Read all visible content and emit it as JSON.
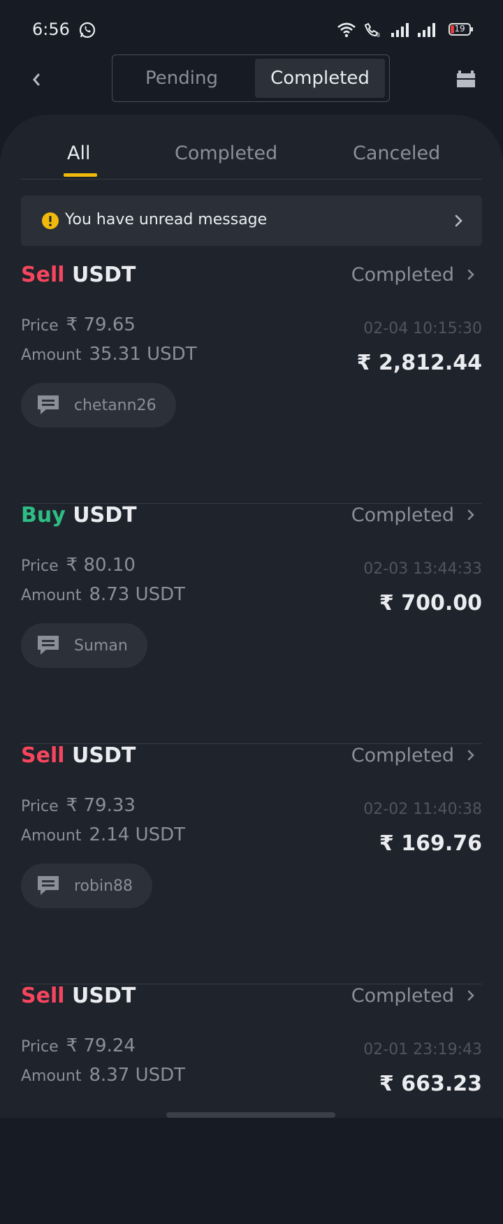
{
  "status_bar": {
    "time": "6:56",
    "battery": "19"
  },
  "header": {
    "segments": {
      "pending": "Pending",
      "completed": "Completed"
    },
    "selected_segment": "Completed"
  },
  "tabs": {
    "all": "All",
    "completed": "Completed",
    "canceled": "Canceled",
    "active": "All"
  },
  "notice": {
    "message": "You have unread message"
  },
  "orders": [
    {
      "side": "Sell",
      "asset": "USDT",
      "status": "Completed",
      "price_label": "Price",
      "price": "₹ 79.65",
      "amount_label": "Amount",
      "amount": "35.31 USDT",
      "timestamp": "02-04 10:15:30",
      "fiat_total": "₹ 2,812.44",
      "counterparty": "chetann26"
    },
    {
      "side": "Buy",
      "asset": "USDT",
      "status": "Completed",
      "price_label": "Price",
      "price": "₹ 80.10",
      "amount_label": "Amount",
      "amount": "8.73 USDT",
      "timestamp": "02-03 13:44:33",
      "fiat_total": "₹ 700.00",
      "counterparty": "Suman"
    },
    {
      "side": "Sell",
      "asset": "USDT",
      "status": "Completed",
      "price_label": "Price",
      "price": "₹ 79.33",
      "amount_label": "Amount",
      "amount": "2.14 USDT",
      "timestamp": "02-02 11:40:38",
      "fiat_total": "₹ 169.76",
      "counterparty": "robin88"
    },
    {
      "side": "Sell",
      "asset": "USDT",
      "status": "Completed",
      "price_label": "Price",
      "price": "₹ 79.24",
      "amount_label": "Amount",
      "amount": "8.37 USDT",
      "timestamp": "02-01 23:19:43",
      "fiat_total": "₹ 663.23",
      "counterparty": ""
    }
  ],
  "colors": {
    "sell": "#f6465d",
    "buy": "#2ebd85",
    "accent": "#f0b90b",
    "background": "#171b23",
    "panel": "#1f232c"
  }
}
